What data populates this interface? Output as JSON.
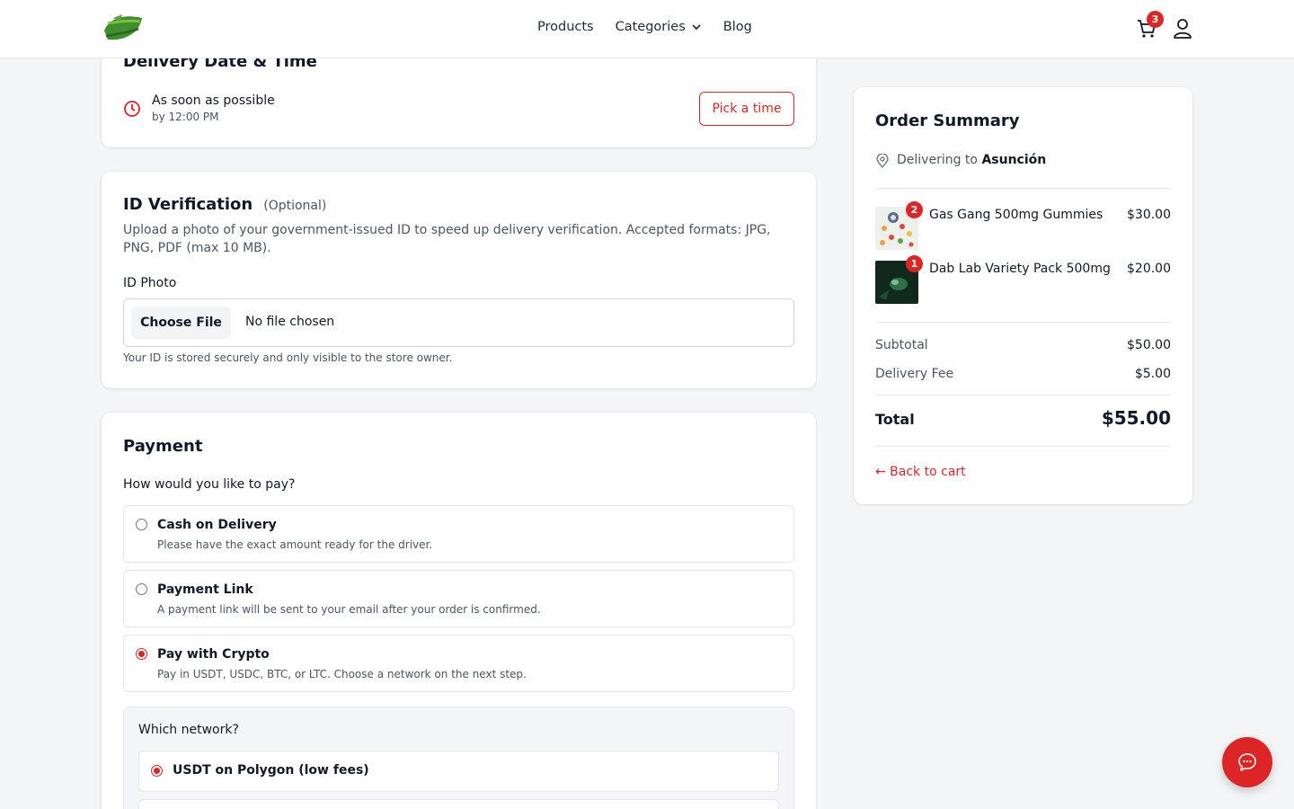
{
  "header": {
    "nav": [
      {
        "label": "Products"
      },
      {
        "label": "Categories"
      },
      {
        "label": "Blog"
      }
    ],
    "cart_count": "3"
  },
  "delivery": {
    "title": "Delivery Date & Time",
    "asap": "As soon as possible",
    "by": "by 12:00 PM",
    "pick_button": "Pick a time"
  },
  "id_verification": {
    "title": "ID Verification",
    "optional": "(Optional)",
    "description": "Upload a photo of your government-issued ID to speed up delivery verification. Accepted formats: JPG, PNG, PDF (max 10 MB).",
    "photo_label": "ID Photo",
    "choose_file": "Choose File",
    "no_file": "No file chosen",
    "note": "Your ID is stored securely and only visible to the store owner."
  },
  "payment": {
    "title": "Payment",
    "question": "How would you like to pay?",
    "options": [
      {
        "title": "Cash on Delivery",
        "desc": "Please have the exact amount ready for the driver.",
        "selected": false
      },
      {
        "title": "Payment Link",
        "desc": "A payment link will be sent to your email after your order is confirmed.",
        "selected": false
      },
      {
        "title": "Pay with Crypto",
        "desc": "Pay in USDT, USDC, BTC, or LTC. Choose a network on the next step.",
        "selected": true
      }
    ],
    "network_question": "Which network?",
    "networks": [
      {
        "title": "USDT on Polygon (low fees)",
        "selected": true
      }
    ]
  },
  "summary": {
    "title": "Order Summary",
    "delivering_prefix": "Delivering to",
    "city": "Asunción",
    "items": [
      {
        "name": "Gas Gang 500mg Gummies",
        "price": "$30.00",
        "qty": "2"
      },
      {
        "name": "Dab Lab Variety Pack 500mg",
        "price": "$20.00",
        "qty": "1"
      }
    ],
    "subtotal_label": "Subtotal",
    "subtotal": "$50.00",
    "fee_label": "Delivery Fee",
    "fee": "$5.00",
    "total_label": "Total",
    "total": "$55.00",
    "back_link": "← Back to cart"
  },
  "colors": {
    "accent": "#dc2626",
    "background": "#f4f5f7"
  }
}
